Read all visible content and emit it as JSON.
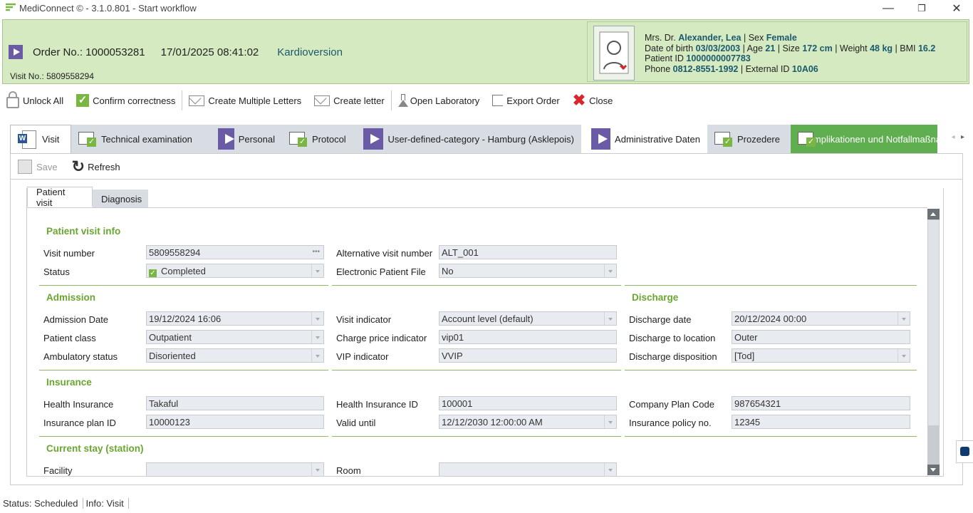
{
  "window": {
    "title": "MediConnect © - 3.1.0.801 - Start workflow",
    "minimize": "—",
    "restore": "❐",
    "close": "✕"
  },
  "header": {
    "order_label": "Order No.: 1000053281",
    "datetime": "17/01/2025 08:41:02",
    "procedure": "Kardioversion",
    "visit_no": "Visit No.: 5809558294",
    "patient": {
      "title": "Mrs. Dr.",
      "name": "Alexander, Lea",
      "sex_label": "Sex",
      "sex": "Female",
      "dob_label": "Date of birth",
      "dob": "03/03/2003",
      "age_label": "Age",
      "age": "21",
      "size_label": "Size",
      "size": "172 cm",
      "weight_label": "Weight",
      "weight": "48 kg",
      "bmi_label": "BMI",
      "bmi": "16.2",
      "pid_label": "Patient ID",
      "pid": "1000000007783",
      "phone_label": "Phone",
      "phone": "0812-8551-1992",
      "extid_label": "External ID",
      "extid": "10A06"
    }
  },
  "toolbar": {
    "unlock_all": "Unlock All",
    "confirm": "Confirm correctness",
    "create_multiple": "Create Multiple Letters",
    "create_letter": "Create letter",
    "open_lab": "Open Laboratory",
    "export_order": "Export Order",
    "close": "Close"
  },
  "tabs": [
    {
      "label": "Visit"
    },
    {
      "label": "Technical examination"
    },
    {
      "label": "Personal"
    },
    {
      "label": "Protocol"
    },
    {
      "label": "User-defined-category - Hamburg (Asklepois)"
    },
    {
      "label": "Administrative Daten"
    },
    {
      "label": "Prozedere"
    },
    {
      "label": "Komplikationen und Notfallmaßnahmen"
    }
  ],
  "subtoolbar": {
    "save": "Save",
    "refresh": "Refresh"
  },
  "subtabs": [
    {
      "label": "Patient visit"
    },
    {
      "label": "Diagnosis"
    }
  ],
  "form": {
    "patient_visit_info": {
      "title": "Patient visit info",
      "visit_number_label": "Visit number",
      "visit_number": "5809558294",
      "alt_visit_label": "Alternative visit number",
      "alt_visit": "ALT_001",
      "status_label": "Status",
      "status": "Completed",
      "epf_label": "Electronic Patient File",
      "epf": "No"
    },
    "admission": {
      "title": "Admission",
      "date_label": "Admission Date",
      "date": "19/12/2024 16:06",
      "visit_ind_label": "Visit indicator",
      "visit_ind": "Account level (default)",
      "class_label": "Patient class",
      "class": "Outpatient",
      "charge_label": "Charge price indicator",
      "charge": "vip01",
      "amb_label": "Ambulatory status",
      "amb": "Disoriented",
      "vip_label": "VIP indicator",
      "vip": "VVIP"
    },
    "discharge": {
      "title": "Discharge",
      "date_label": "Discharge date",
      "date": "20/12/2024 00:00",
      "location_label": "Discharge to location",
      "location": "Outer",
      "disposition_label": "Discharge disposition",
      "disposition": "[Tod]"
    },
    "insurance": {
      "title": "Insurance",
      "health_label": "Health Insurance",
      "health": "Takaful",
      "health_id_label": "Health Insurance ID",
      "health_id": "100001",
      "company_label": "Company Plan Code",
      "company": "987654321",
      "plan_label": "Insurance plan ID",
      "plan": "10000123",
      "valid_label": "Valid until",
      "valid": "12/12/2030 12:00:00 AM",
      "policy_label": "Insurance policy no.",
      "policy": "12345"
    },
    "current_stay": {
      "title": "Current stay (station)",
      "facility_label": "Facility",
      "facility": "",
      "room_label": "Room",
      "room": ""
    }
  },
  "status_bar": {
    "status": "Status: Scheduled",
    "info": "Info: Visit"
  },
  "colors": {
    "header_bg": "#d5eac0",
    "accent_green": "#6aa632",
    "play_purple": "#6b5aa6",
    "teal_text": "#1b5a6e"
  }
}
